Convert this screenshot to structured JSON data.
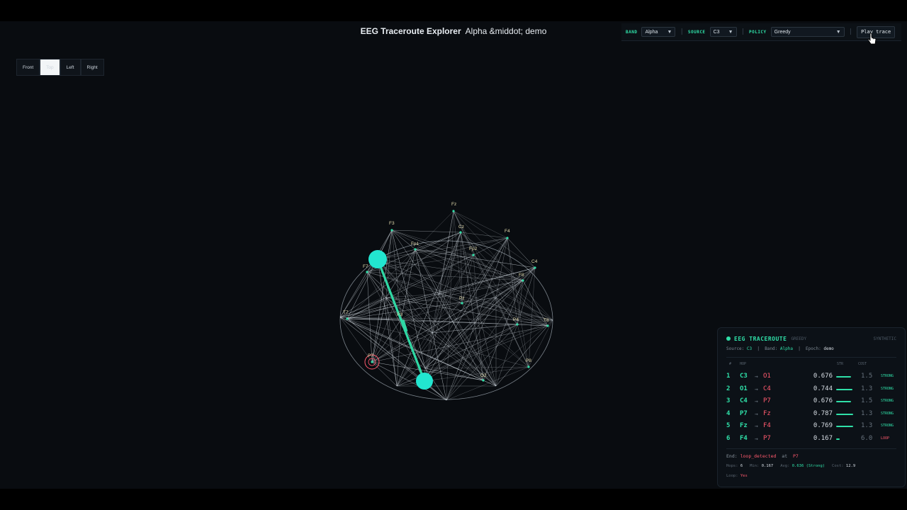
{
  "header": {
    "title": "EEG Traceroute Explorer",
    "subtitle": "Alpha &middot; demo"
  },
  "controls": {
    "band_label": "BAND",
    "band_value": "Alpha",
    "source_label": "SOURCE",
    "source_value": "C3",
    "policy_label": "POLICY",
    "policy_value": "Greedy",
    "play_label": "Play trace"
  },
  "views": [
    "Front",
    "Top",
    "Left",
    "Right"
  ],
  "active_view": "Top",
  "electrodes": [
    "Fz",
    "F3",
    "Cz",
    "F4",
    "Fp1",
    "Fp2",
    "C4",
    "F7",
    "F8",
    "T7",
    "Pz",
    "P3",
    "P4",
    "T8",
    "P7",
    "P8",
    "O2"
  ],
  "panel": {
    "title": "EEG TRACEROUTE",
    "policy": "GREEDY",
    "synthetic": "SYNTHETIC",
    "source_label": "Source:",
    "source": "C3",
    "band_label": "Band:",
    "band": "Alpha",
    "epoch_label": "Epoch:",
    "epoch": "demo",
    "col_index": "#",
    "col_hop": "HOP",
    "col_str": "STR",
    "col_cost": "COST",
    "hops": [
      {
        "i": "1",
        "from": "C3",
        "to": "O1",
        "str": "0.676",
        "cost": "1.5",
        "status": "STRONG",
        "strength": 0.676
      },
      {
        "i": "2",
        "from": "O1",
        "to": "C4",
        "str": "0.744",
        "cost": "1.3",
        "status": "STRONG",
        "strength": 0.744
      },
      {
        "i": "3",
        "from": "C4",
        "to": "P7",
        "str": "0.676",
        "cost": "1.5",
        "status": "STRONG",
        "strength": 0.676
      },
      {
        "i": "4",
        "from": "P7",
        "to": "Fz",
        "str": "0.787",
        "cost": "1.3",
        "status": "STRONG",
        "strength": 0.787
      },
      {
        "i": "5",
        "from": "Fz",
        "to": "F4",
        "str": "0.769",
        "cost": "1.3",
        "status": "STRONG",
        "strength": 0.769
      },
      {
        "i": "6",
        "from": "F4",
        "to": "P7",
        "str": "0.167",
        "cost": "6.0",
        "status": "LOOP",
        "strength": 0.167
      }
    ],
    "end_label": "End:",
    "end_value": "loop_detected",
    "at_label": "at",
    "end_node": "P7",
    "hops_label": "Hops:",
    "hops_value": "6",
    "min_label": "Min:",
    "min_value": "0.167",
    "avg_label": "Avg:",
    "avg_value": "0.636 (Strong)",
    "cost_label": "Cost:",
    "cost_value": "12.9",
    "loop_label": "Loop:",
    "loop_value": "Yes"
  },
  "colors": {
    "accent": "#2fe0a8",
    "danger": "#ff5a6e",
    "node_highlight": "#22e6d0"
  }
}
